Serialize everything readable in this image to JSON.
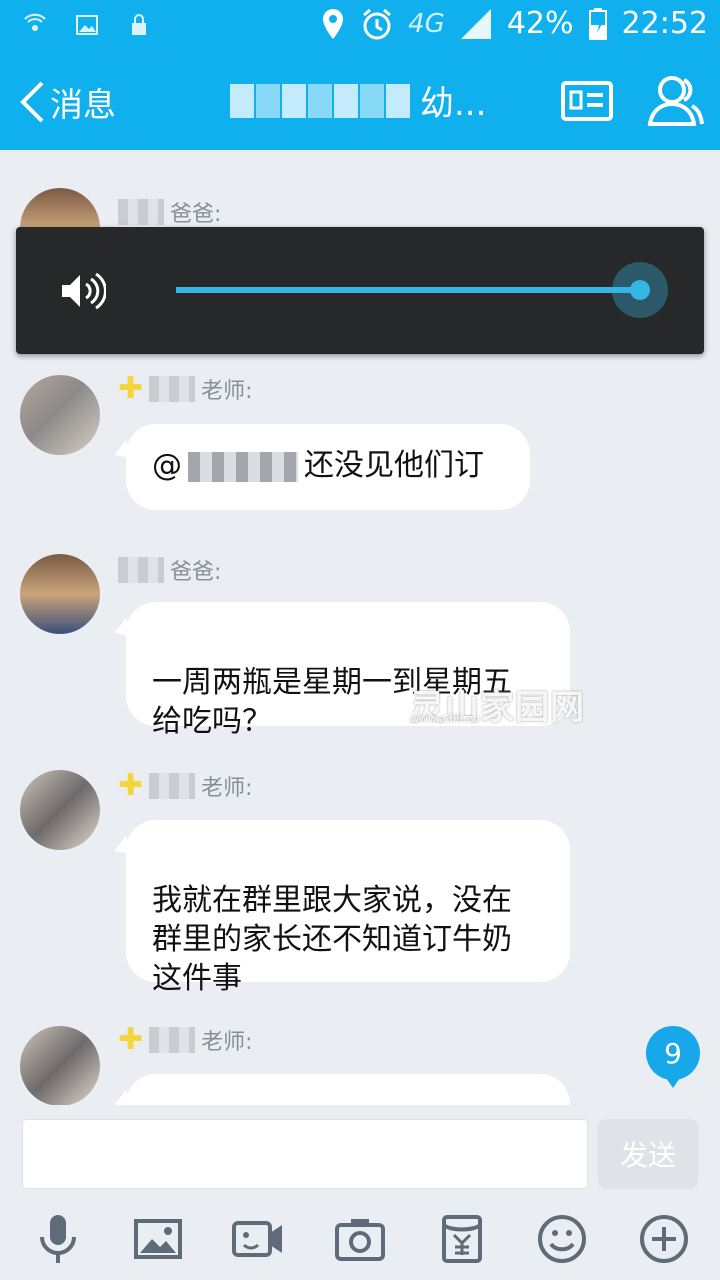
{
  "status_bar": {
    "battery": "42%",
    "time": "22:52",
    "network": "4G"
  },
  "header": {
    "back_label": "消息",
    "title_suffix": "幼..."
  },
  "messages": [
    {
      "sender_suffix": "爸爸:",
      "text": ""
    },
    {
      "sender_suffix": "老师:",
      "text_prefix": "@",
      "text_suffix": "还没见他们订"
    },
    {
      "sender_suffix": "爸爸:",
      "text": "一周两瓶是星期一到星期五\n给吃吗？"
    },
    {
      "sender_suffix": "老师:",
      "text": "我就在群里跟大家说，没在\n群里的家长还不知道订牛奶\n这件事"
    },
    {
      "sender_suffix": "老师:",
      "text": ""
    }
  ],
  "volume": {
    "level": 1.0
  },
  "watermark": {
    "title": "灵山家园网",
    "url": "www.al09.cn"
  },
  "unread_count": "9",
  "composer": {
    "placeholder": "",
    "send_label": "发送"
  },
  "toolbar_icons": [
    "microphone-icon",
    "image-icon",
    "video-chat-icon",
    "camera-icon",
    "red-packet-icon",
    "emoji-icon",
    "plus-icon"
  ],
  "colors": {
    "brand": "#10b0ef",
    "accent": "#33b5e5"
  }
}
